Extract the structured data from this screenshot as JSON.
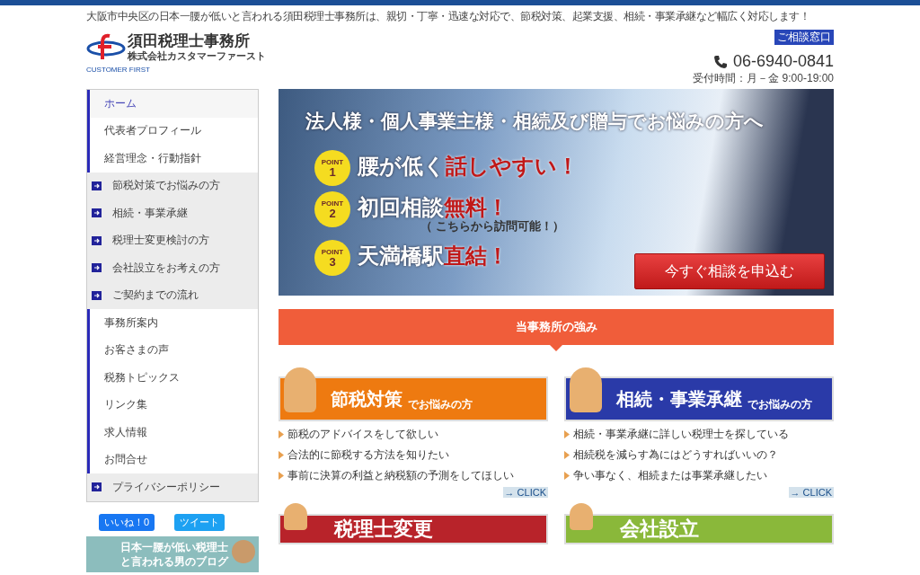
{
  "header": {
    "tagline": "大阪市中央区の日本一腰が低いと言われる須田税理士事務所は、親切・丁寧・迅速な対応で、節税対策、起業支援、相続・事業承継など幅広く対応します！",
    "logo_name": "須田税理士事務所",
    "logo_company": "株式会社カスタマーファースト",
    "logo_small": "CUSTOMER FIRST",
    "contact_badge": "ご相談窓口",
    "phone": "06-6940-0841",
    "hours": "受付時間：月－金 9:00-19:00"
  },
  "sidebar": {
    "items": [
      {
        "label": "ホーム",
        "kind": "page",
        "selected": true
      },
      {
        "label": "代表者プロフィール",
        "kind": "page",
        "selected": false
      },
      {
        "label": "経営理念・行動指針",
        "kind": "page",
        "selected": false
      },
      {
        "label": "節税対策でお悩みの方",
        "kind": "section",
        "selected": false
      },
      {
        "label": "相続・事業承継",
        "kind": "section",
        "selected": false
      },
      {
        "label": "税理士変更検討の方",
        "kind": "section",
        "selected": false
      },
      {
        "label": "会社設立をお考えの方",
        "kind": "section",
        "selected": false
      },
      {
        "label": "ご契約までの流れ",
        "kind": "section",
        "selected": false
      },
      {
        "label": "事務所案内",
        "kind": "page",
        "selected": false
      },
      {
        "label": "お客さまの声",
        "kind": "page",
        "selected": false
      },
      {
        "label": "税務トピックス",
        "kind": "page",
        "selected": false
      },
      {
        "label": "リンク集",
        "kind": "page",
        "selected": false
      },
      {
        "label": "求人情報",
        "kind": "page",
        "selected": false
      },
      {
        "label": "お問合せ",
        "kind": "page",
        "selected": false
      },
      {
        "label": "プライバシーポリシー",
        "kind": "section",
        "selected": false
      }
    ],
    "like_button": "いいね！0",
    "tweet_button": "ツイート",
    "blog_banner": [
      "日本一腰が低い税理士",
      "と言われる男のブログ"
    ]
  },
  "hero": {
    "headline": "法人様・個人事業主様・相続及び贈与でお悩みの方へ",
    "points": [
      {
        "badge": "POINT",
        "number": "1",
        "parts": [
          {
            "text": "腰が低く",
            "accent": false
          },
          {
            "text": "話しやすい！",
            "accent": true
          }
        ]
      },
      {
        "badge": "POINT",
        "number": "2",
        "parts": [
          {
            "text": "初回相談",
            "accent": false
          },
          {
            "text": "無料！",
            "accent": true
          }
        ],
        "note": "（ こちらから訪問可能！）"
      },
      {
        "badge": "POINT",
        "number": "3",
        "parts": [
          {
            "text": "天満橋駅",
            "accent": false
          },
          {
            "text": "直結！",
            "accent": true
          }
        ]
      }
    ],
    "cta": "今すぐ相談を申込む"
  },
  "strengths": {
    "heading": "当事務所の強み",
    "cards": [
      {
        "title": "節税対策",
        "subtitle": "でお悩みの方",
        "color": "#ee7a10",
        "bullets": [
          "節税のアドバイスをして欲しい",
          "合法的に節税する方法を知りたい",
          "事前に決算の利益と納税額の予測をしてほしい"
        ],
        "link": "→ CLICK"
      },
      {
        "title": "相続・事業承継",
        "subtitle": "でお悩みの方",
        "color": "#2a3aa8",
        "bullets": [
          "相続・事業承継に詳しい税理士を探している",
          "相続税を減らす為にはどうすればいいの？",
          "争い事なく、相続または事業承継したい"
        ],
        "link": "→ CLICK"
      }
    ],
    "more_banners": [
      {
        "title": "税理士変更",
        "color": "#b8232a"
      },
      {
        "title": "会社設立",
        "color": "#8ab83a"
      }
    ]
  }
}
